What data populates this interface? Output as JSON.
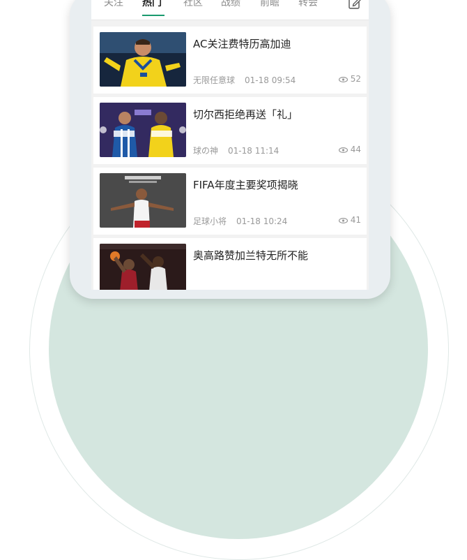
{
  "tabs": [
    {
      "label": "关注",
      "active": false
    },
    {
      "label": "热门",
      "active": true
    },
    {
      "label": "社区",
      "active": false
    },
    {
      "label": "战绩",
      "active": false
    },
    {
      "label": "前瞻",
      "active": false
    },
    {
      "label": "转会",
      "active": false
    }
  ],
  "edit_icon": "edit-icon",
  "accent_color": "#1a9a6e",
  "articles": [
    {
      "title": "AC关注费特历高加迪",
      "author": "无限任意球",
      "date": "01-18 09:54",
      "views": "52",
      "thumb": "footballer-celebrating-yellow-kit"
    },
    {
      "title": "切尔西拒绝再送「礼」",
      "author": "球の神",
      "date": "01-18 11:14",
      "views": "44",
      "thumb": "two-players-match-graphic"
    },
    {
      "title": "FIFA年度主要奖项揭晓",
      "author": "足球小将",
      "date": "01-18 10:24",
      "views": "41",
      "thumb": "the-best-award-player"
    },
    {
      "title": "奥高路赞加兰特无所不能",
      "author": "",
      "date": "",
      "views": "",
      "thumb": "basketball-players-red-jerseys"
    }
  ]
}
